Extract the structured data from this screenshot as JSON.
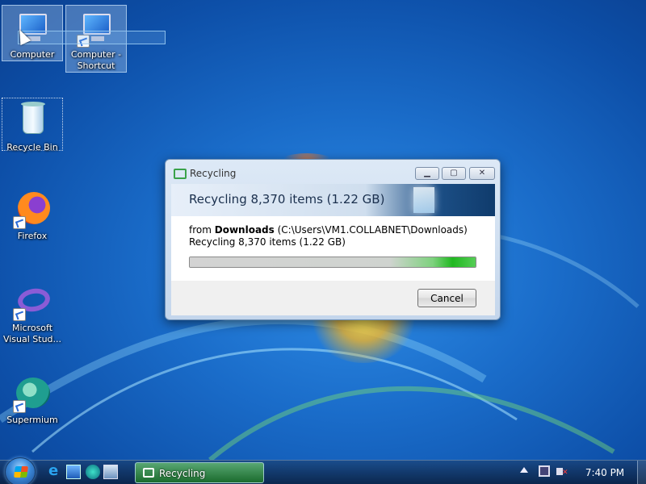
{
  "desktop": {
    "icons": [
      {
        "label": "Computer"
      },
      {
        "label": "Computer -\nShortcut"
      },
      {
        "label": "Recycle Bin"
      },
      {
        "label": "Firefox"
      },
      {
        "label": "Microsoft\nVisual Stud..."
      },
      {
        "label": "Supermium"
      }
    ]
  },
  "dialog": {
    "title": "Recycling",
    "heading": "Recycling 8,370 items (1.22 GB)",
    "from_prefix": "from ",
    "from_folder": "Downloads",
    "from_path": " (C:\\Users\\VM1.COLLABNET\\Downloads)",
    "status": "Recycling 8,370 items (1.22 GB)",
    "progress_percent": 100,
    "cancel_label": "Cancel",
    "min_glyph": "▁",
    "max_glyph": "▢",
    "close_glyph": "✕"
  },
  "taskbar": {
    "task_label": "Recycling",
    "clock": "7:40 PM"
  }
}
